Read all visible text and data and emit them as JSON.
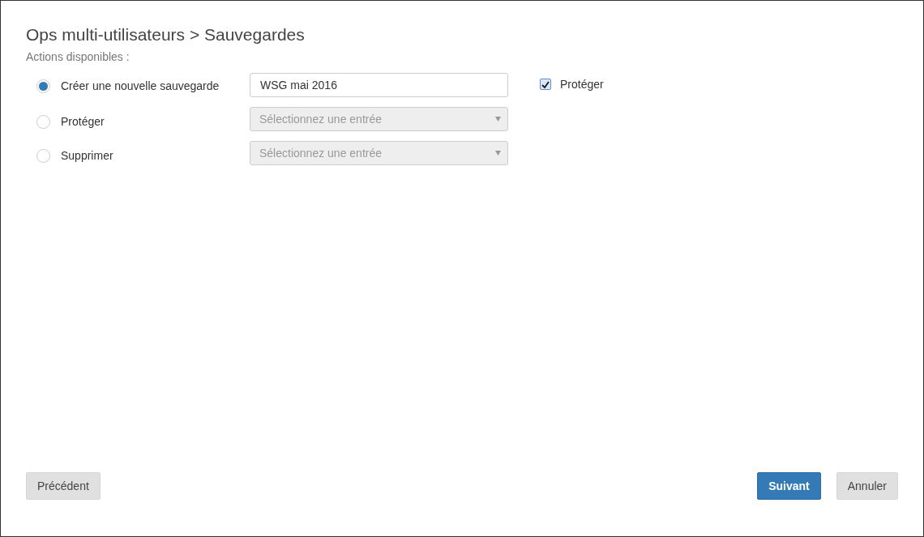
{
  "title": "Ops multi-utilisateurs > Sauvegardes",
  "subtitle": "Actions disponibles :",
  "actions": [
    {
      "label": "Créer une nouvelle sauvegarde",
      "selected": true,
      "field": {
        "kind": "input",
        "value": "WSG mai 2016",
        "disabled": false
      },
      "option": {
        "label": "Protéger",
        "checked": true
      }
    },
    {
      "label": "Protéger",
      "selected": false,
      "field": {
        "kind": "select",
        "placeholder": "Sélectionnez une entrée",
        "disabled": true
      }
    },
    {
      "label": "Supprimer",
      "selected": false,
      "field": {
        "kind": "select",
        "placeholder": "Sélectionnez une entrée",
        "disabled": true
      }
    }
  ],
  "buttons_left": [
    {
      "label": "Précédent",
      "kind": "default"
    }
  ],
  "buttons_right": [
    {
      "label": "Suivant",
      "kind": "primary"
    },
    {
      "label": "Annuler",
      "kind": "default"
    }
  ]
}
